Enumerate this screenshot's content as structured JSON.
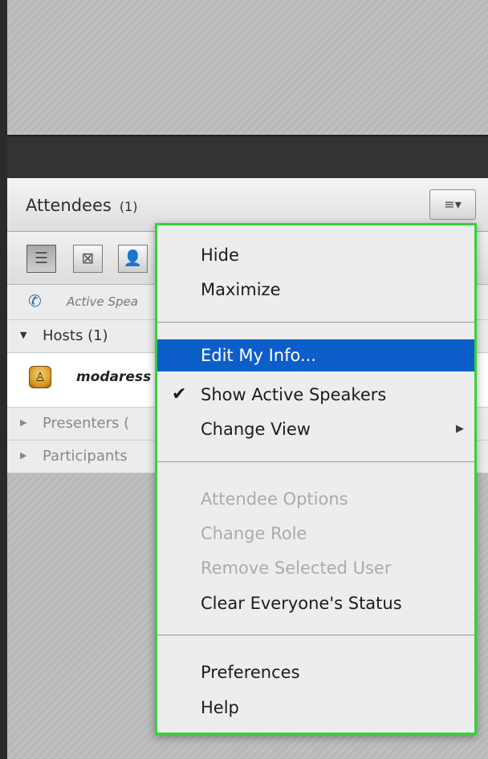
{
  "attendees_pod": {
    "title": "Attendees",
    "count": "(1)",
    "menu_button_icon": "pod-menu-icon",
    "view_buttons": [
      "list-view-icon",
      "grid-view-icon",
      "status-view-icon"
    ],
    "active_speakers_label": "Active Spea",
    "groups": {
      "hosts": "Hosts (1)",
      "presenters": "Presenters (",
      "participants": "Participants"
    },
    "user_name": "modaress"
  },
  "menu": {
    "hide": "Hide",
    "maximize": "Maximize",
    "edit_info": "Edit My Info...",
    "show_active_speakers": "Show Active Speakers",
    "show_active_speakers_check": "✔",
    "change_view": "Change View",
    "change_view_arrow": "▶",
    "attendee_options": "Attendee Options",
    "change_role": "Change Role",
    "remove_selected_user": "Remove Selected User",
    "clear_status": "Clear Everyone's Status",
    "preferences": "Preferences",
    "help": "Help"
  },
  "colors": {
    "highlight": "#0c5ec9",
    "menu_border": "#37d13b",
    "disabled_text": "#ababab"
  }
}
